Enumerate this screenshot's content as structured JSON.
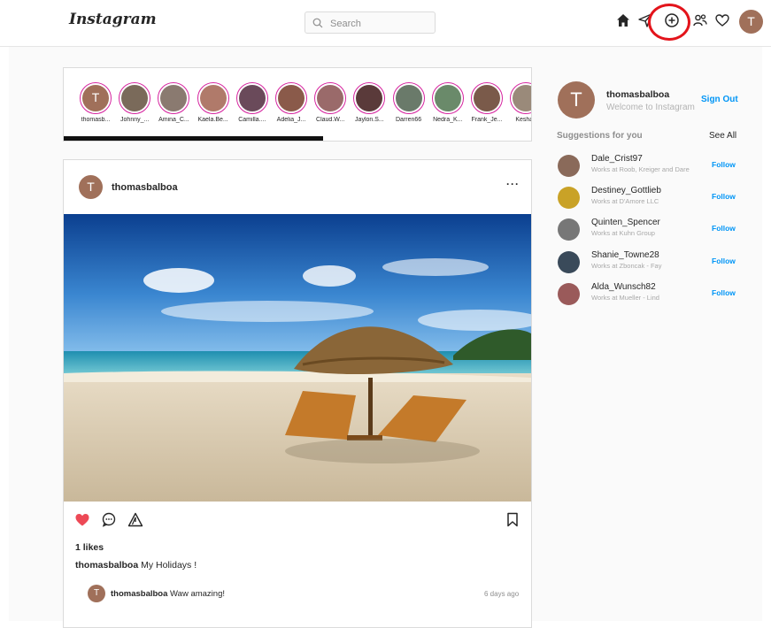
{
  "header": {
    "logo": "Instagram",
    "search_placeholder": "Search",
    "avatar_letter": "T"
  },
  "stories": [
    {
      "label": "thomasb...",
      "color": "#a0705a",
      "letter": "T"
    },
    {
      "label": "Johnny_...",
      "color": "#7a6a5a",
      "letter": ""
    },
    {
      "label": "Amina_C...",
      "color": "#8a7a70",
      "letter": ""
    },
    {
      "label": "Kaela.Be...",
      "color": "#b07a6a",
      "letter": ""
    },
    {
      "label": "Camilla....",
      "color": "#6a4a5a",
      "letter": ""
    },
    {
      "label": "Adelia_J...",
      "color": "#8a5a4a",
      "letter": ""
    },
    {
      "label": "Claud.W...",
      "color": "#9a6a6a",
      "letter": ""
    },
    {
      "label": "Jaylon.S...",
      "color": "#5a3a3a",
      "letter": ""
    },
    {
      "label": "Darren66",
      "color": "#6a7a6a",
      "letter": ""
    },
    {
      "label": "Nedra_K...",
      "color": "#6a8a6a",
      "letter": ""
    },
    {
      "label": "Frank_Je...",
      "color": "#7a5a4a",
      "letter": ""
    },
    {
      "label": "Keshau",
      "color": "#9a8a7a",
      "letter": ""
    }
  ],
  "post": {
    "avatar_letter": "T",
    "username": "thomasbalboa",
    "more": "···",
    "likes": "1 likes",
    "caption_user": "thomasbalboa",
    "caption_text": "My Holidays !",
    "comment_avatar_letter": "T",
    "comment_user": "thomasbalboa",
    "comment_text": "Waw amazing!",
    "comment_time": "6 days ago",
    "liked": true
  },
  "sidebar": {
    "avatar_letter": "T",
    "username": "thomasbalboa",
    "welcome": "Welcome to Instagram",
    "sign_out": "Sign Out",
    "suggestions_title": "Suggestions for you",
    "see_all": "See All",
    "suggestions": [
      {
        "name": "Dale_Crist97",
        "sub": "Works at Roob, Kreiger and Dare",
        "follow": "Follow",
        "color": "#8a6a5a"
      },
      {
        "name": "Destiney_Gottlieb",
        "sub": "Works at D'Amore LLC",
        "follow": "Follow",
        "color": "#c9a227"
      },
      {
        "name": "Quinten_Spencer",
        "sub": "Works at Kuhn Group",
        "follow": "Follow",
        "color": "#777777"
      },
      {
        "name": "Shanie_Towne28",
        "sub": "Works at Zboncak - Fay",
        "follow": "Follow",
        "color": "#3a4a5a"
      },
      {
        "name": "Alda_Wunsch82",
        "sub": "Works at Mueller - Lind",
        "follow": "Follow",
        "color": "#9a5a5a"
      }
    ]
  },
  "colors": {
    "accent": "#0095f6",
    "like": "#ed4956",
    "highlight": "#e3141b",
    "avatar": "#a0705a"
  }
}
